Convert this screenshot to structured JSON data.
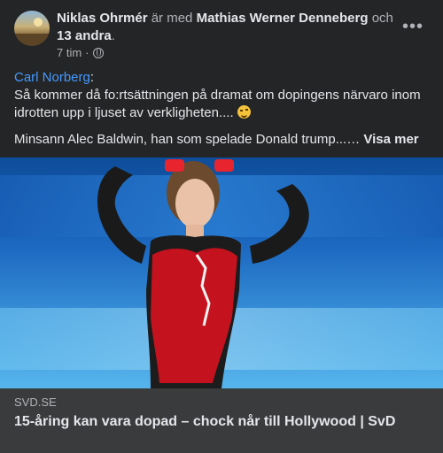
{
  "post": {
    "author": "Niklas Ohrmér",
    "with_text": " är med ",
    "tagged_person": "Mathias Werner Denneberg",
    "and_text": " och ",
    "others": "13 andra",
    "period": ".",
    "time": "7 tim",
    "separator": "·",
    "privacy_icon": "globe-icon",
    "menu_icon": "more-options-icon",
    "menu_label": "•••",
    "mention": "Carl Norberg",
    "mention_suffix": ":",
    "text1": "Så kommer då fo:rtsättningen på dramat om dopingens närvaro inom idrotten upp i ljuset av verkligheten.... ",
    "emoji": "winking-face-emoji",
    "text2": "Minsann Alec Baldwin, han som spelade Donald trump...… ",
    "see_more": "Visa mer"
  },
  "link": {
    "domain": "SVD.SE",
    "title": "15-åring kan vara dopad – chock når till Hollywood | SvD",
    "image": "figure-skater-photo"
  },
  "colors": {
    "background": "#242526",
    "card": "#3a3b3c",
    "link_blue": "#4599ff",
    "text": "#e4e6eb",
    "muted": "#b0b3b8"
  }
}
